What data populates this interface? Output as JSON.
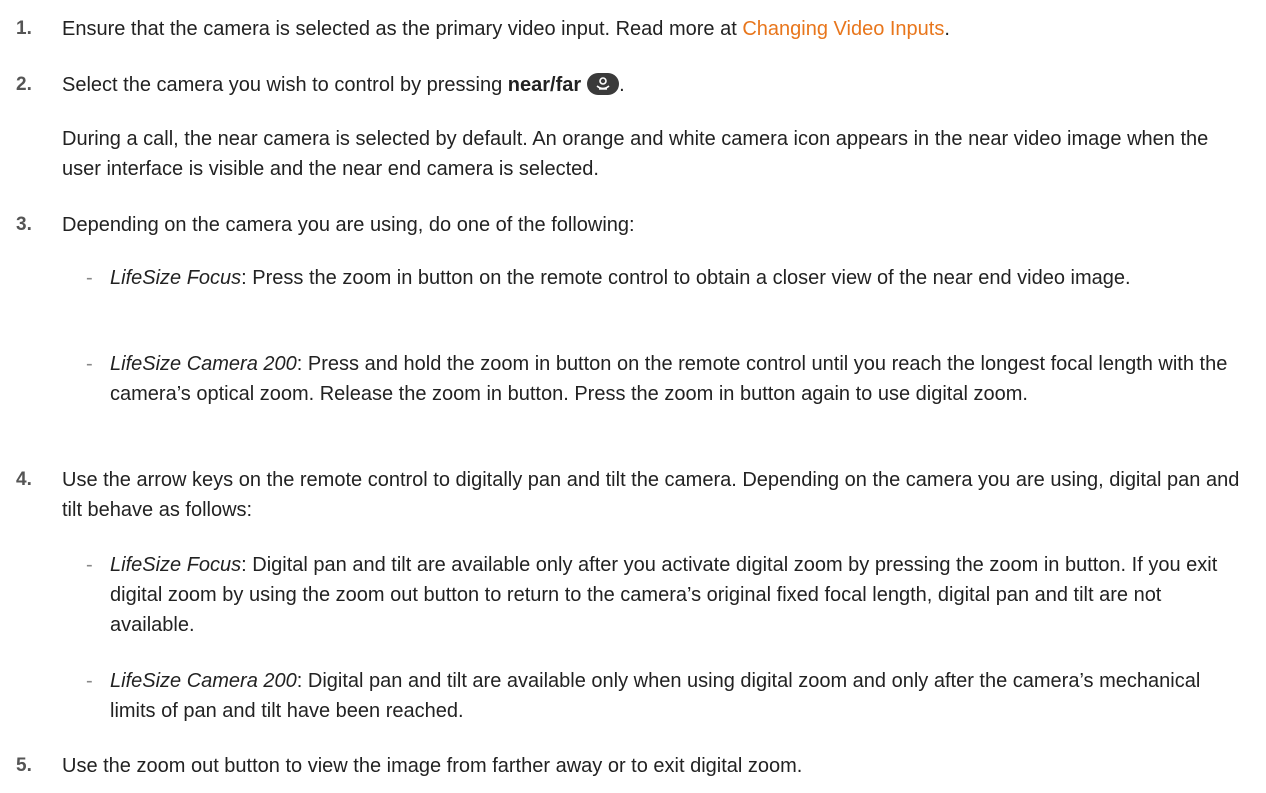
{
  "steps": [
    {
      "num": "1.",
      "text": "Ensure that the camera is selected as the primary video input. Read more at ",
      "link": "Changing Video Inputs",
      "after": "."
    },
    {
      "num": "2.",
      "before": "Select the camera you wish to control by pressing ",
      "bold": "near/far",
      "after": ".",
      "icon": "near-far-camera-icon",
      "note": "During a call, the near camera is selected by default. An orange and white camera icon appears in the near video image when the user interface is visible and the near end camera is selected."
    },
    {
      "num": "3.",
      "text": "Depending on the camera you are using, do one of the following:",
      "subs": [
        {
          "dash": "-",
          "label": "LifeSize Focus",
          "text": ": Press the zoom in button on the remote control to obtain a closer view of the near end video image."
        },
        {
          "dash": "-",
          "label": "LifeSize Camera 200",
          "text": ": Press and hold the zoom in button on the remote control until you reach the longest focal length with the camera’s optical zoom. Release the zoom in button. Press the zoom in button again to use digital zoom."
        }
      ]
    },
    {
      "num": "4.",
      "text": "Use the arrow keys on the remote control to digitally pan and tilt the camera. Depending on the camera you are using, digital pan and tilt behave as follows:",
      "subs": [
        {
          "dash": "-",
          "label": "LifeSize Focus",
          "text": ": Digital pan and tilt are available only after you activate digital zoom by pressing the zoom in button. If you exit digital zoom by using the zoom out button to return to the camera’s original fixed focal length, digital pan and tilt are not available."
        },
        {
          "dash": "-",
          "label": "LifeSize Camera 200",
          "text": ": Digital pan and tilt are available only when using digital zoom and only after the camera’s mechanical limits of pan and tilt have been reached."
        }
      ]
    },
    {
      "num": "5.",
      "text": "Use the zoom out button to view the image from farther away or to exit digital zoom."
    }
  ],
  "colors": {
    "link": "#e8761c",
    "text": "#222222",
    "number": "#555555",
    "icon_bg": "#3a3a3a"
  }
}
